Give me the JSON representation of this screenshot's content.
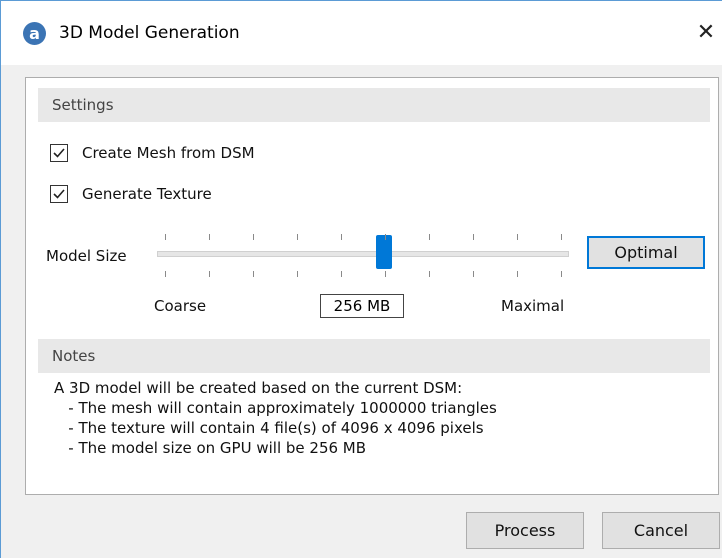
{
  "window": {
    "title": "3D Model Generation",
    "app_icon_glyph": "a",
    "close_glyph": "✕"
  },
  "settings": {
    "header": "Settings",
    "create_mesh": {
      "label": "Create Mesh from DSM",
      "checked": true
    },
    "generate_texture": {
      "label": "Generate Texture",
      "checked": true
    },
    "model_size": {
      "label": "Model Size",
      "min_label": "Coarse",
      "max_label": "Maximal",
      "value_text": "256 MB",
      "slider_level": 0.55,
      "optimal_button": "Optimal"
    }
  },
  "notes": {
    "header": "Notes",
    "lines": [
      "A 3D model will be created based on the current DSM:",
      "   - The mesh will contain approximately 1000000 triangles",
      "   - The texture will contain 4 file(s) of 4096 x 4096 pixels",
      "   - The model size on GPU will be 256 MB"
    ]
  },
  "footer": {
    "process_button": "Process",
    "cancel_button": "Cancel"
  },
  "colors": {
    "accent": "#0078d7",
    "app_icon": "#3b74b4"
  }
}
